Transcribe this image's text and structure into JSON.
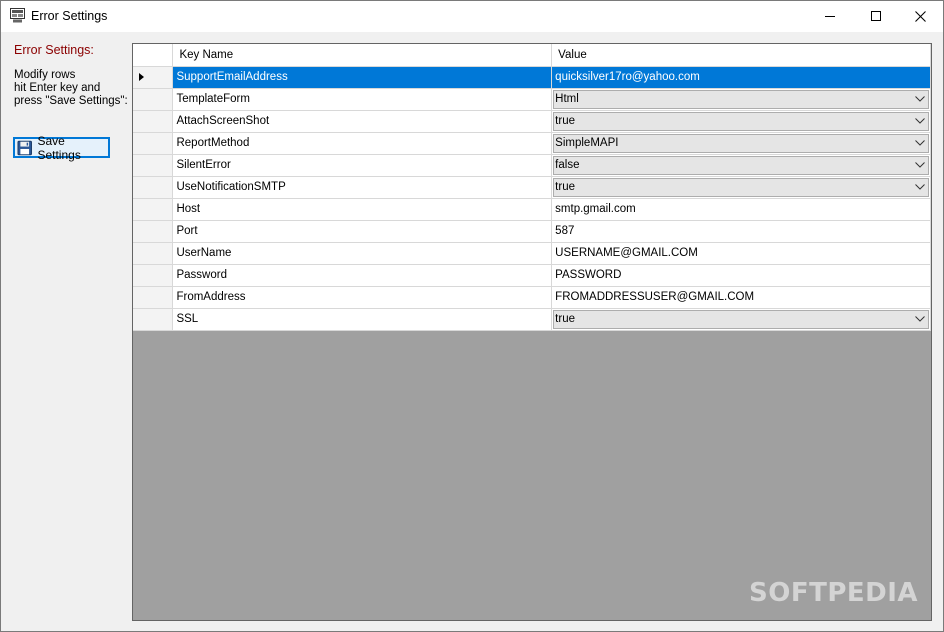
{
  "window": {
    "title": "Error Settings",
    "app_icon": "app-icon"
  },
  "controls": {
    "minimize_icon": "minimize-icon",
    "maximize_icon": "maximize-icon",
    "close_icon": "close-icon"
  },
  "left_panel": {
    "title": "Error Settings:",
    "instructions": "Modify rows\nhit Enter key and\npress \"Save Settings\":",
    "save_button": {
      "label": "Save Settings",
      "icon": "floppy-disk-icon"
    }
  },
  "grid": {
    "columns": [
      "Key Name",
      "Value"
    ],
    "rows": [
      {
        "key": "SupportEmailAddress",
        "value": "quicksilver17ro@yahoo.com",
        "type": "text",
        "selected": true
      },
      {
        "key": "TemplateForm",
        "value": "Html",
        "type": "combo"
      },
      {
        "key": "AttachScreenShot",
        "value": "true",
        "type": "combo"
      },
      {
        "key": "ReportMethod",
        "value": "SimpleMAPI",
        "type": "combo"
      },
      {
        "key": "SilentError",
        "value": "false",
        "type": "combo"
      },
      {
        "key": "UseNotificationSMTP",
        "value": "true",
        "type": "combo"
      },
      {
        "key": "Host",
        "value": "smtp.gmail.com",
        "type": "text"
      },
      {
        "key": "Port",
        "value": "587",
        "type": "text"
      },
      {
        "key": "UserName",
        "value": "USERNAME@GMAIL.COM",
        "type": "text"
      },
      {
        "key": "Password",
        "value": "PASSWORD",
        "type": "text"
      },
      {
        "key": "FromAddress",
        "value": "FROMADDRESSUSER@GMAIL.COM",
        "type": "text"
      },
      {
        "key": "SSL",
        "value": "true",
        "type": "combo"
      }
    ]
  },
  "watermark": "SOFTPEDIA",
  "colors": {
    "accent": "#0078d7",
    "title_red": "#8b0000",
    "grid_empty": "#a0a0a0"
  }
}
